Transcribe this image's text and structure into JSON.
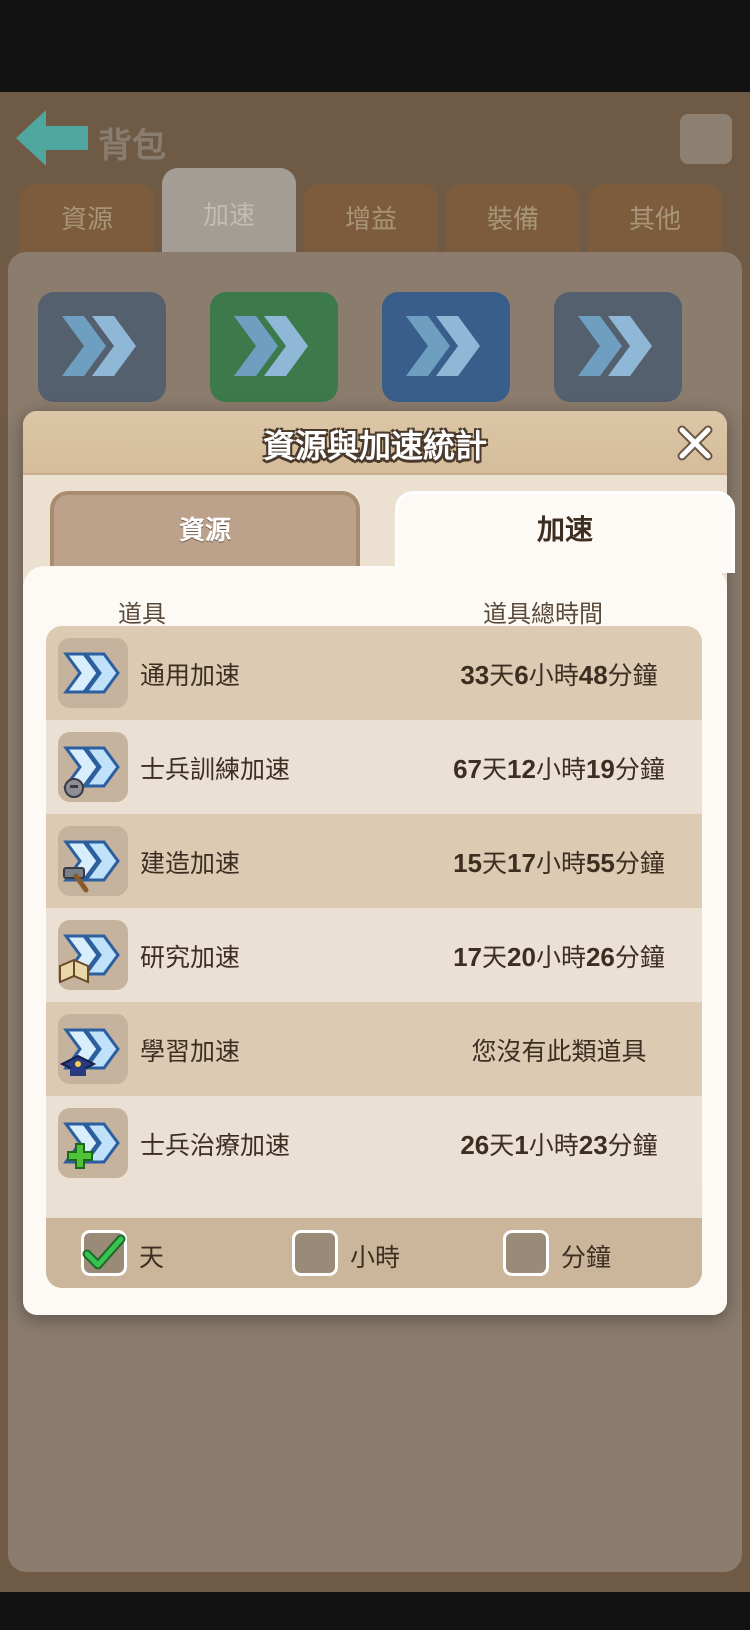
{
  "background": {
    "title": "背包",
    "tabs": [
      "資源",
      "加速",
      "增益",
      "裝備",
      "其他"
    ],
    "active_tab": 1
  },
  "modal": {
    "title": "資源與加速統計",
    "tabs": {
      "resources": "資源",
      "speedup": "加速"
    },
    "active_tab": "speedup",
    "columns": {
      "item": "道具",
      "total_time": "道具總時間"
    },
    "rows": [
      {
        "name": "通用加速",
        "icon": "universal-speedup-icon",
        "time": [
          [
            "33",
            "天"
          ],
          [
            "6",
            "小時"
          ],
          [
            "48",
            "分鐘"
          ]
        ]
      },
      {
        "name": "士兵訓練加速",
        "icon": "training-speedup-icon",
        "time": [
          [
            "67",
            "天"
          ],
          [
            "12",
            "小時"
          ],
          [
            "19",
            "分鐘"
          ]
        ]
      },
      {
        "name": "建造加速",
        "icon": "building-speedup-icon",
        "time": [
          [
            "15",
            "天"
          ],
          [
            "17",
            "小時"
          ],
          [
            "55",
            "分鐘"
          ]
        ]
      },
      {
        "name": "研究加速",
        "icon": "research-speedup-icon",
        "time": [
          [
            "17",
            "天"
          ],
          [
            "20",
            "小時"
          ],
          [
            "26",
            "分鐘"
          ]
        ]
      },
      {
        "name": "學習加速",
        "icon": "learning-speedup-icon",
        "time_text": "您沒有此類道具"
      },
      {
        "name": "士兵治療加速",
        "icon": "healing-speedup-icon",
        "time": [
          [
            "26",
            "天"
          ],
          [
            "1",
            "小時"
          ],
          [
            "23",
            "分鐘"
          ]
        ]
      }
    ],
    "units": [
      {
        "label": "天",
        "checked": true
      },
      {
        "label": "小時",
        "checked": false
      },
      {
        "label": "分鐘",
        "checked": false
      }
    ]
  },
  "colors": {
    "accent_check": "#2fb54a",
    "row_dark": "#dccab3",
    "row_light": "#eae0d4"
  }
}
